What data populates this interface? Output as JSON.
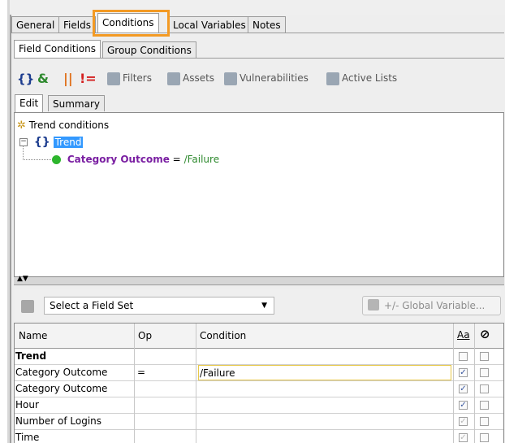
{
  "main_tabs": [
    {
      "label": "General"
    },
    {
      "label": "Fields"
    },
    {
      "label": "Conditions"
    },
    {
      "label": "Local Variables"
    },
    {
      "label": "Notes"
    }
  ],
  "sub_tabs": [
    {
      "label": "Field Conditions"
    },
    {
      "label": "Group Conditions"
    }
  ],
  "toolbar": {
    "filters": "Filters",
    "assets": "Assets",
    "vulnerabilities": "Vulnerabilities",
    "active_lists": "Active Lists"
  },
  "view_tabs": [
    {
      "label": "Edit"
    },
    {
      "label": "Summary"
    }
  ],
  "tree": {
    "root": "Trend conditions",
    "node": "Trend",
    "condition_field": "Category Outcome",
    "condition_op": "=",
    "condition_value": "/Failure"
  },
  "field_set": {
    "select_value": "Select a Field Set",
    "global_variable_button": "+/- Global Variable..."
  },
  "table": {
    "headers": {
      "name": "Name",
      "op": "Op",
      "condition": "Condition",
      "case": "Aa"
    },
    "rows": [
      {
        "name": "Trend",
        "op": "",
        "condition": "",
        "bold": true,
        "case_checked": false,
        "case_enabled": false
      },
      {
        "name": "Category Outcome",
        "op": "=",
        "condition": "/Failure",
        "bold": false,
        "case_checked": true,
        "case_enabled": true
      },
      {
        "name": "Category Outcome",
        "op": "",
        "condition": "",
        "bold": false,
        "case_checked": true,
        "case_enabled": true
      },
      {
        "name": "Hour",
        "op": "",
        "condition": "",
        "bold": false,
        "case_checked": true,
        "case_enabled": true
      },
      {
        "name": "Number of Logins",
        "op": "",
        "condition": "",
        "bold": false,
        "case_checked": true,
        "case_enabled": false
      },
      {
        "name": "Time",
        "op": "",
        "condition": "",
        "bold": false,
        "case_checked": true,
        "case_enabled": false
      }
    ]
  },
  "colors": {
    "highlight": "#f39a24",
    "selection": "#3399ff",
    "condition_field": "#7a1fa2",
    "condition_value": "#2f8a2f"
  }
}
